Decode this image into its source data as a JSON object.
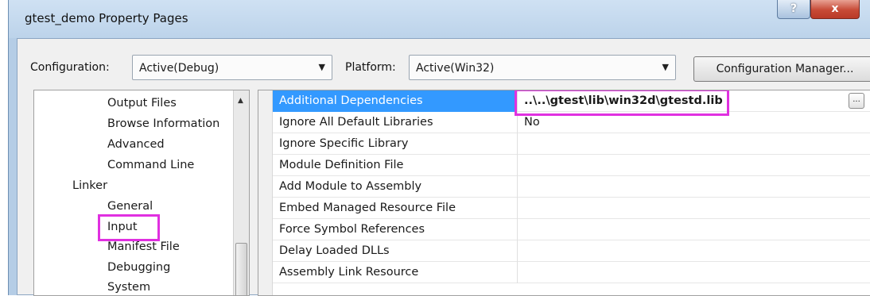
{
  "window": {
    "title": "gtest_demo Property Pages",
    "help_glyph": "?",
    "close_glyph": "x"
  },
  "config": {
    "configuration_label": "Configuration:",
    "configuration_value": "Active(Debug)",
    "platform_label": "Platform:",
    "platform_value": "Active(Win32)",
    "dropdown_arrow": "▼",
    "manager_button": "Configuration Manager..."
  },
  "tree": {
    "scroll_up_glyph": "▲",
    "items": [
      {
        "label": "Output Files"
      },
      {
        "label": "Browse Information"
      },
      {
        "label": "Advanced"
      },
      {
        "label": "Command Line"
      },
      {
        "label": "Linker"
      },
      {
        "label": "General"
      },
      {
        "label": "Input"
      },
      {
        "label": "Manifest File"
      },
      {
        "label": "Debugging"
      },
      {
        "label": "System"
      }
    ]
  },
  "grid": {
    "ellipsis_label": "...",
    "rows": [
      {
        "name": "Additional Dependencies",
        "value": "..\\..\\gtest\\lib\\win32d\\gtestd.lib"
      },
      {
        "name": "Ignore All Default Libraries",
        "value": "No"
      },
      {
        "name": "Ignore Specific Library",
        "value": ""
      },
      {
        "name": "Module Definition File",
        "value": ""
      },
      {
        "name": "Add Module to Assembly",
        "value": ""
      },
      {
        "name": "Embed Managed Resource File",
        "value": ""
      },
      {
        "name": "Force Symbol References",
        "value": ""
      },
      {
        "name": "Delay Loaded DLLs",
        "value": ""
      },
      {
        "name": "Assembly Link Resource",
        "value": ""
      }
    ]
  },
  "colors": {
    "highlight_box": "#e030e0",
    "selection": "#3399ff"
  }
}
